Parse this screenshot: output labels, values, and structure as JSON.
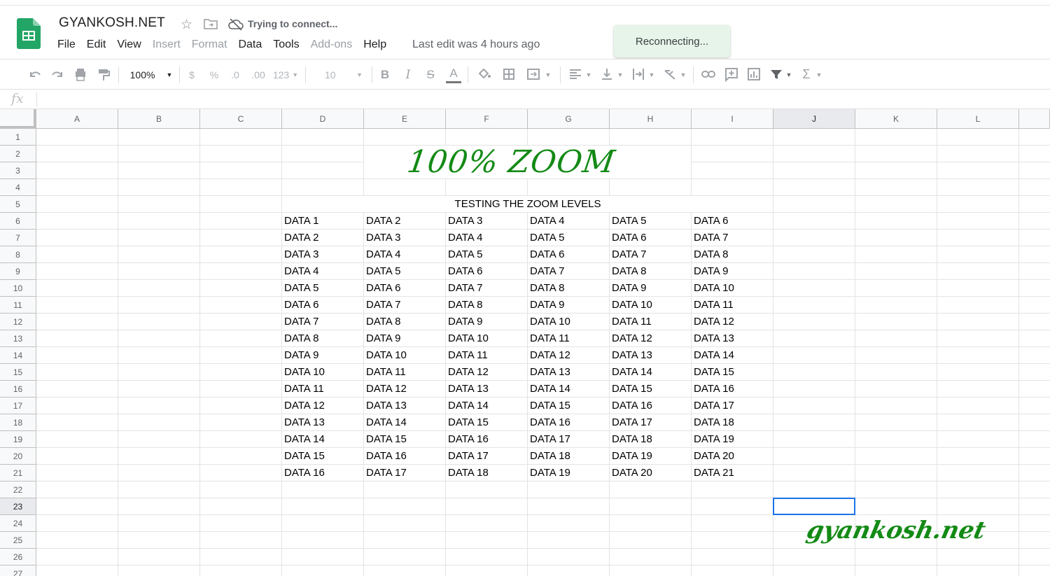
{
  "doc": {
    "title": "GYANKOSH.NET",
    "connection_status": "Trying to connect...",
    "last_edit": "Last edit was 4 hours ago"
  },
  "menu": [
    {
      "label": "File",
      "enabled": true
    },
    {
      "label": "Edit",
      "enabled": true
    },
    {
      "label": "View",
      "enabled": true
    },
    {
      "label": "Insert",
      "enabled": false
    },
    {
      "label": "Format",
      "enabled": false
    },
    {
      "label": "Data",
      "enabled": true
    },
    {
      "label": "Tools",
      "enabled": true
    },
    {
      "label": "Add-ons",
      "enabled": false
    },
    {
      "label": "Help",
      "enabled": true
    }
  ],
  "toast": {
    "message": "Reconnecting..."
  },
  "toolbar": {
    "zoom": "100%",
    "currency": "$",
    "percent": "%",
    "decrease_decimal": ".0",
    "increase_decimal": ".00",
    "more_formats": "123",
    "font_size": "10",
    "bold": "B",
    "italic": "I",
    "strikethrough": "S",
    "text_color": "A",
    "functions": "Σ"
  },
  "formula_bar": {
    "fx": "fx",
    "value": ""
  },
  "sheet": {
    "columns": [
      "A",
      "B",
      "C",
      "D",
      "E",
      "F",
      "G",
      "H",
      "I",
      "J",
      "K",
      "L"
    ],
    "selected_column": "J",
    "rows": [
      "1",
      "2",
      "3",
      "4",
      "5",
      "6",
      "7",
      "8",
      "9",
      "10",
      "11",
      "12",
      "13",
      "14",
      "15",
      "16",
      "17",
      "18",
      "19",
      "20",
      "21",
      "22",
      "23",
      "24",
      "25",
      "26",
      "27"
    ],
    "selected_row": "23",
    "zoom_title": "100% ZOOM",
    "section_title": "TESTING THE ZOOM LEVELS",
    "data_rows": [
      [
        "DATA 1",
        "DATA 2",
        "DATA 3",
        "DATA 4",
        "DATA 5",
        "DATA 6"
      ],
      [
        "DATA 2",
        "DATA 3",
        "DATA 4",
        "DATA 5",
        "DATA 6",
        "DATA 7"
      ],
      [
        "DATA 3",
        "DATA 4",
        "DATA 5",
        "DATA 6",
        "DATA 7",
        "DATA 8"
      ],
      [
        "DATA 4",
        "DATA 5",
        "DATA 6",
        "DATA 7",
        "DATA 8",
        "DATA 9"
      ],
      [
        "DATA 5",
        "DATA 6",
        "DATA 7",
        "DATA 8",
        "DATA 9",
        "DATA 10"
      ],
      [
        "DATA 6",
        "DATA 7",
        "DATA 8",
        "DATA 9",
        "DATA 10",
        "DATA 11"
      ],
      [
        "DATA 7",
        "DATA 8",
        "DATA 9",
        "DATA 10",
        "DATA 11",
        "DATA 12"
      ],
      [
        "DATA 8",
        "DATA 9",
        "DATA 10",
        "DATA 11",
        "DATA 12",
        "DATA 13"
      ],
      [
        "DATA 9",
        "DATA 10",
        "DATA 11",
        "DATA 12",
        "DATA 13",
        "DATA 14"
      ],
      [
        "DATA 10",
        "DATA 11",
        "DATA 12",
        "DATA 13",
        "DATA 14",
        "DATA 15"
      ],
      [
        "DATA 11",
        "DATA 12",
        "DATA 13",
        "DATA 14",
        "DATA 15",
        "DATA 16"
      ],
      [
        "DATA 12",
        "DATA 13",
        "DATA 14",
        "DATA 15",
        "DATA 16",
        "DATA 17"
      ],
      [
        "DATA 13",
        "DATA 14",
        "DATA 15",
        "DATA 16",
        "DATA 17",
        "DATA 18"
      ],
      [
        "DATA 14",
        "DATA 15",
        "DATA 16",
        "DATA 17",
        "DATA 18",
        "DATA 19"
      ],
      [
        "DATA 15",
        "DATA 16",
        "DATA 17",
        "DATA 18",
        "DATA 19",
        "DATA 20"
      ],
      [
        "DATA 16",
        "DATA 17",
        "DATA 18",
        "DATA 19",
        "DATA 20",
        "DATA 21"
      ]
    ],
    "watermark": "gyankosh.net"
  },
  "colors": {
    "accent_green": "#138a15",
    "selection_blue": "#1a73e8",
    "toast_bg": "#e6f4ea"
  }
}
